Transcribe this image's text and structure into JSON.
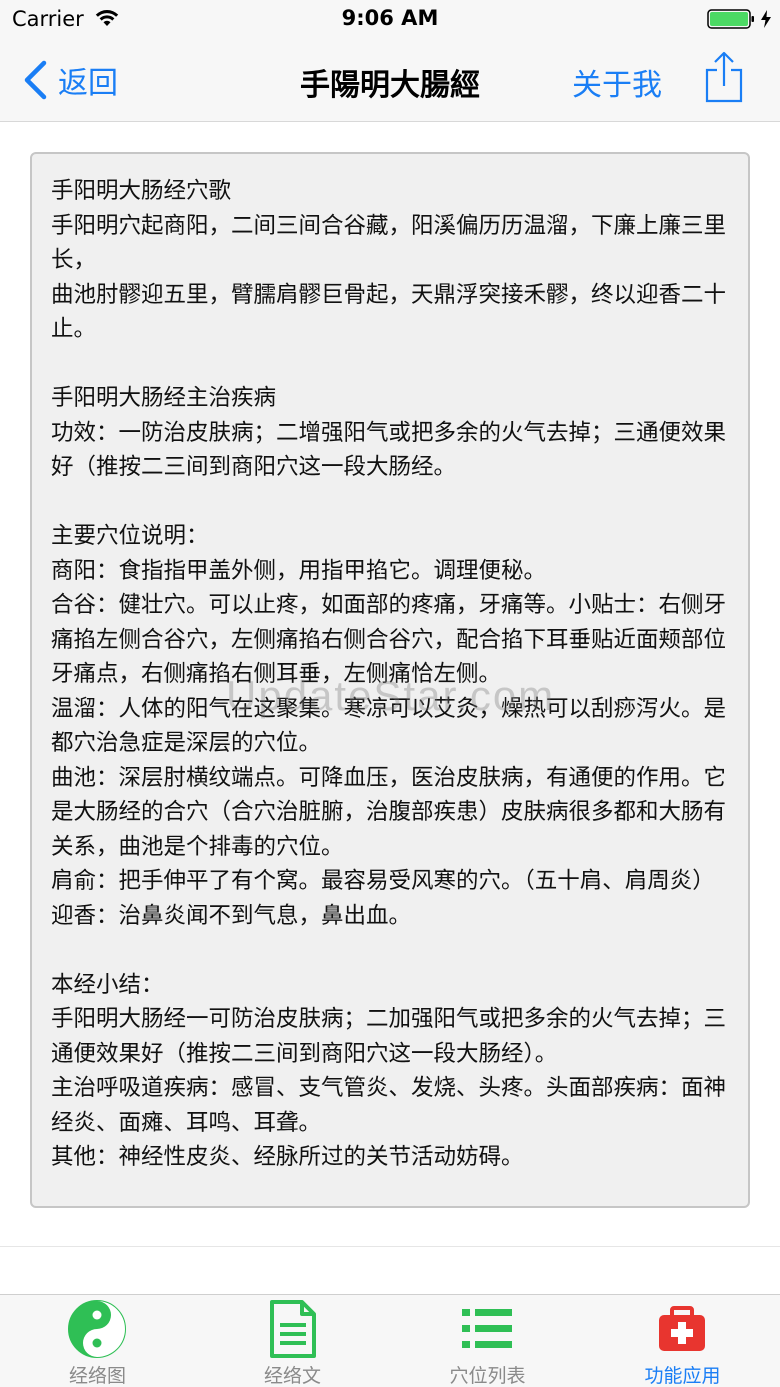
{
  "status_bar": {
    "carrier": "Carrier",
    "time": "9:06 AM"
  },
  "nav": {
    "back_label": "返回",
    "title": "手陽明大腸經",
    "about_label": "关于我"
  },
  "content": {
    "text": "手阳明大肠经穴歌\n手阳明穴起商阳，二间三间合谷藏，阳溪偏历历温溜，下廉上廉三里长，\n曲池肘髎迎五里，臂臑肩髎巨骨起，天鼎浮突接禾髎，终以迎香二十止。\n\n手阳明大肠经主治疾病\n功效：一防治皮肤病；二增强阳气或把多余的火气去掉；三通便效果好（推按二三间到商阳穴这一段大肠经。\n\n主要穴位说明：\n商阳：食指指甲盖外侧，用指甲掐它。调理便秘。\n合谷：健壮穴。可以止疼，如面部的疼痛，牙痛等。小贴士：右侧牙痛掐左侧合谷穴，左侧痛掐右侧合谷穴，配合掐下耳垂贴近面颊部位牙痛点，右侧痛掐右侧耳垂，左侧痛恰左侧。\n温溜：人体的阳气在这聚集。寒凉可以艾灸，燥热可以刮痧泻火。是都穴治急症是深层的穴位。\n曲池：深层肘横纹端点。可降血压，医治皮肤病，有通便的作用。它是大肠经的合穴（合穴治脏腑，治腹部疾患）皮肤病很多都和大肠有关系，曲池是个排毒的穴位。\n肩俞：把手伸平了有个窝。最容易受风寒的穴。（五十肩、肩周炎）\n迎香：治鼻炎闻不到气息，鼻出血。\n\n本经小结：\n手阳明大肠经一可防治皮肤病；二加强阳气或把多余的火气去掉；三通便效果好（推按二三间到商阳穴这一段大肠经）。\n主治呼吸道疾病：感冒、支气管炎、发烧、头疼。头面部疾病：面神经炎、面瘫、耳鸣、耳聋。\n其他：神经性皮炎、经脉所过的关节活动妨碍。"
  },
  "watermark": "UpdateStar.com",
  "tabs": [
    {
      "label": "经络图",
      "icon": "yin-yang-icon",
      "active": false
    },
    {
      "label": "经络文",
      "icon": "document-icon",
      "active": false
    },
    {
      "label": "穴位列表",
      "icon": "list-icon",
      "active": false
    },
    {
      "label": "功能应用",
      "icon": "first-aid-kit-icon",
      "active": true
    }
  ],
  "colors": {
    "accent": "#1a7ef5",
    "tab_green": "#2fbf55",
    "tab_red": "#e8352f",
    "battery": "#4cd964"
  }
}
